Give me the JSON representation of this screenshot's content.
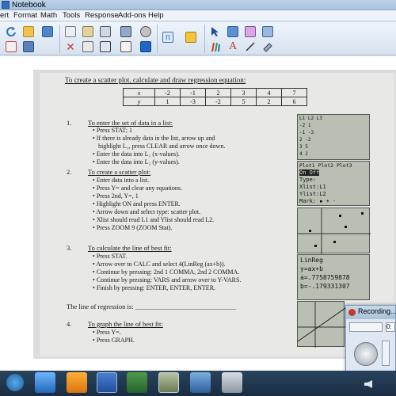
{
  "window": {
    "title": "Notebook"
  },
  "menu": [
    "ert",
    "Format",
    "Math",
    "Tools",
    "Response",
    "Add-ons",
    "Help"
  ],
  "doc": {
    "heading": "To create a scatter plot, calculate and draw regression equation:",
    "table": {
      "row_x": [
        "x",
        "-2",
        "-1",
        "2",
        "3",
        "4",
        "7"
      ],
      "row_y": [
        "y",
        "1",
        "-3",
        "-2",
        "5",
        "2",
        "6"
      ]
    },
    "s1": {
      "num": "1.",
      "title": "To enter the set of data in a list:",
      "items": [
        "Press STAT; 1",
        "If there is already data in the list, arrow up and",
        "highlight L₁, press CLEAR and arrow once down.",
        "Enter the data into L₁ (x-values).",
        "Enter the data into L₂ (y-values)."
      ]
    },
    "s2": {
      "num": "2.",
      "title": "To create a scatter plot:",
      "items": [
        "Enter data into a list.",
        "Press Y= and clear any equations.",
        "Press 2nd, Y=, 1",
        "Highlight ON and press ENTER.",
        "Arrow down and select type:  scatter plot.",
        "Xlist should read L1 and Ylist should read L2.",
        "Press ZOOM 9 (ZOOM Stat)."
      ]
    },
    "s3": {
      "num": "3.",
      "title": "To calculate the line of best fit:",
      "items": [
        "Press STAT.",
        "Arrow over to CALC and select 4(LinReg (ax+b)).",
        "Continue by pressing: 2nd 1 COMMA, 2nd 2 COMMA.",
        "Continue by pressing: VARS and arrow over to Y-VARS.",
        "Finish by pressing:  ENTER, ENTER, ENTER."
      ]
    },
    "regression_line": "The line of regression is: ______________________________",
    "s4": {
      "num": "4.",
      "title": "To graph the line of best fit:",
      "items": [
        "Press Y=.",
        "Press GRAPH."
      ]
    }
  },
  "calc_screens": {
    "list": [
      "L1      L2      L3",
      "-2      1",
      "-1     -3",
      "2      -2",
      "3       5",
      "4       2"
    ],
    "plot": [
      "Plot1 Plot2 Plot3",
      "On Off",
      "Type:",
      "Xlist:L1",
      "Ylist:L2",
      "Mark: ▪ + ·"
    ],
    "linreg": [
      "LinReg",
      "y=ax+b",
      "a=.7758759878",
      "b=-.179331307"
    ]
  },
  "recording": {
    "title": "Recording...",
    "field": "0:"
  }
}
